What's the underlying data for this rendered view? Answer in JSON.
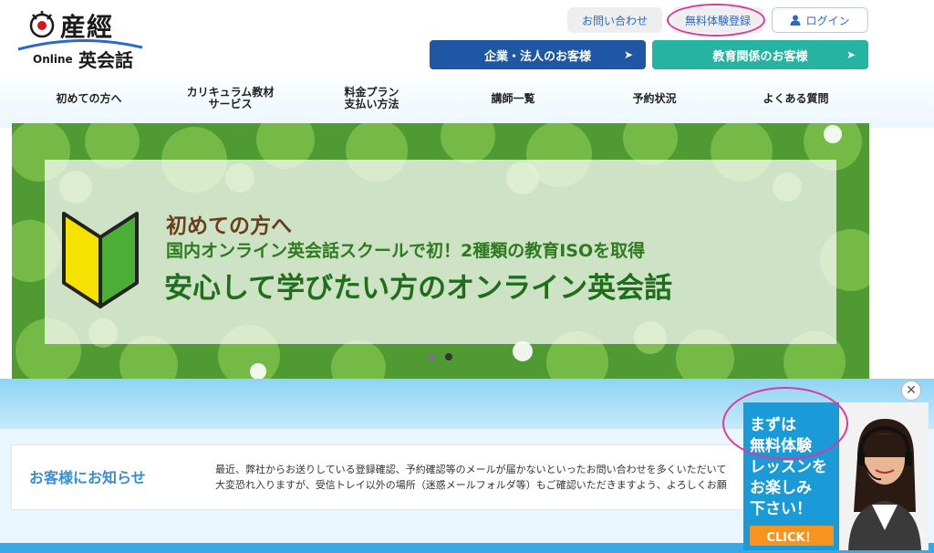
{
  "header": {
    "logo_title": "産經",
    "logo_online": "Online",
    "logo_eikaiwa": "英会話",
    "contact_label": "お問い合わせ",
    "trial_label": "無料体験登録",
    "login_label": "ログイン",
    "corp_label": "企業・法人のお客様",
    "edu_label": "教育関係のお客様",
    "arrow": "➤"
  },
  "nav": {
    "items": [
      {
        "line1": "初めての方へ",
        "line2": ""
      },
      {
        "line1": "カリキュラム教材",
        "line2": "サービス"
      },
      {
        "line1": "料金プラン",
        "line2": "支払い方法"
      },
      {
        "line1": "講師一覧",
        "line2": ""
      },
      {
        "line1": "予約状況",
        "line2": ""
      },
      {
        "line1": "よくある質問",
        "line2": ""
      }
    ]
  },
  "hero": {
    "line1": "初めての方へ",
    "line2": "国内オンライン英会話スクールで初！2種類の教育ISOを取得",
    "line3": "安心して学びたい方のオンライン英会話"
  },
  "notice": {
    "title": "お客様にお知らせ",
    "line1": "最近、弊社からお送りしている登録確認、予約確認等のメールが届かないといったお問い合わせを多くいただいて",
    "line2": "大変恐れ入りますが、受信トレイ以外の場所（迷惑メールフォルダ等）もご確認いただきますよう、よろしくお願"
  },
  "promo": {
    "line1": "まずは",
    "line2": "無料体験",
    "line3": "レッスンを",
    "line4": "お楽しみ",
    "line5": "下さい！",
    "click_label": "CLICK！",
    "close_symbol": "✕"
  },
  "colors": {
    "accent_blue": "#1f57a5",
    "accent_teal": "#26b4a2",
    "annotation_pink": "#e0369e",
    "promo_blue": "#1a9ad6",
    "promo_orange": "#f7931e"
  }
}
